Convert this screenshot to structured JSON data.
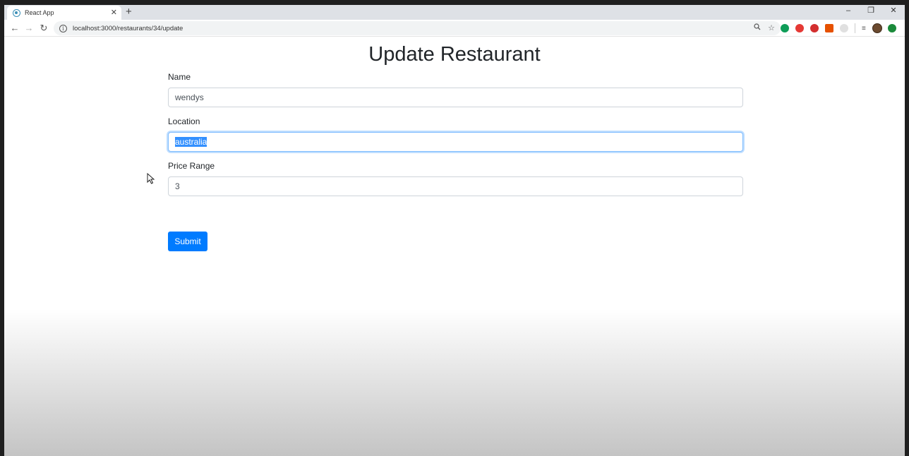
{
  "browser": {
    "tab_title": "React App",
    "tab_close": "✕",
    "new_tab": "+",
    "url": "localhost:3000/restaurants/34/update",
    "window_controls": {
      "minimize": "–",
      "restore": "❐",
      "close": "✕"
    },
    "nav": {
      "back": "←",
      "forward": "→",
      "reload": "↻"
    }
  },
  "page": {
    "title": "Update Restaurant",
    "fields": [
      {
        "label": "Name",
        "value": "wendys"
      },
      {
        "label": "Location",
        "value": "australia"
      },
      {
        "label": "Price Range",
        "value": "3"
      }
    ],
    "submit_label": "Submit"
  },
  "colors": {
    "primary": "#007bff",
    "focus_border": "#80bdff",
    "selection": "#3390ff",
    "text": "#212529"
  },
  "icons": [
    "react-favicon",
    "info-icon",
    "zoom-icon",
    "star-icon",
    "extension-icons",
    "avatar",
    "mouse-cursor-icon"
  ]
}
